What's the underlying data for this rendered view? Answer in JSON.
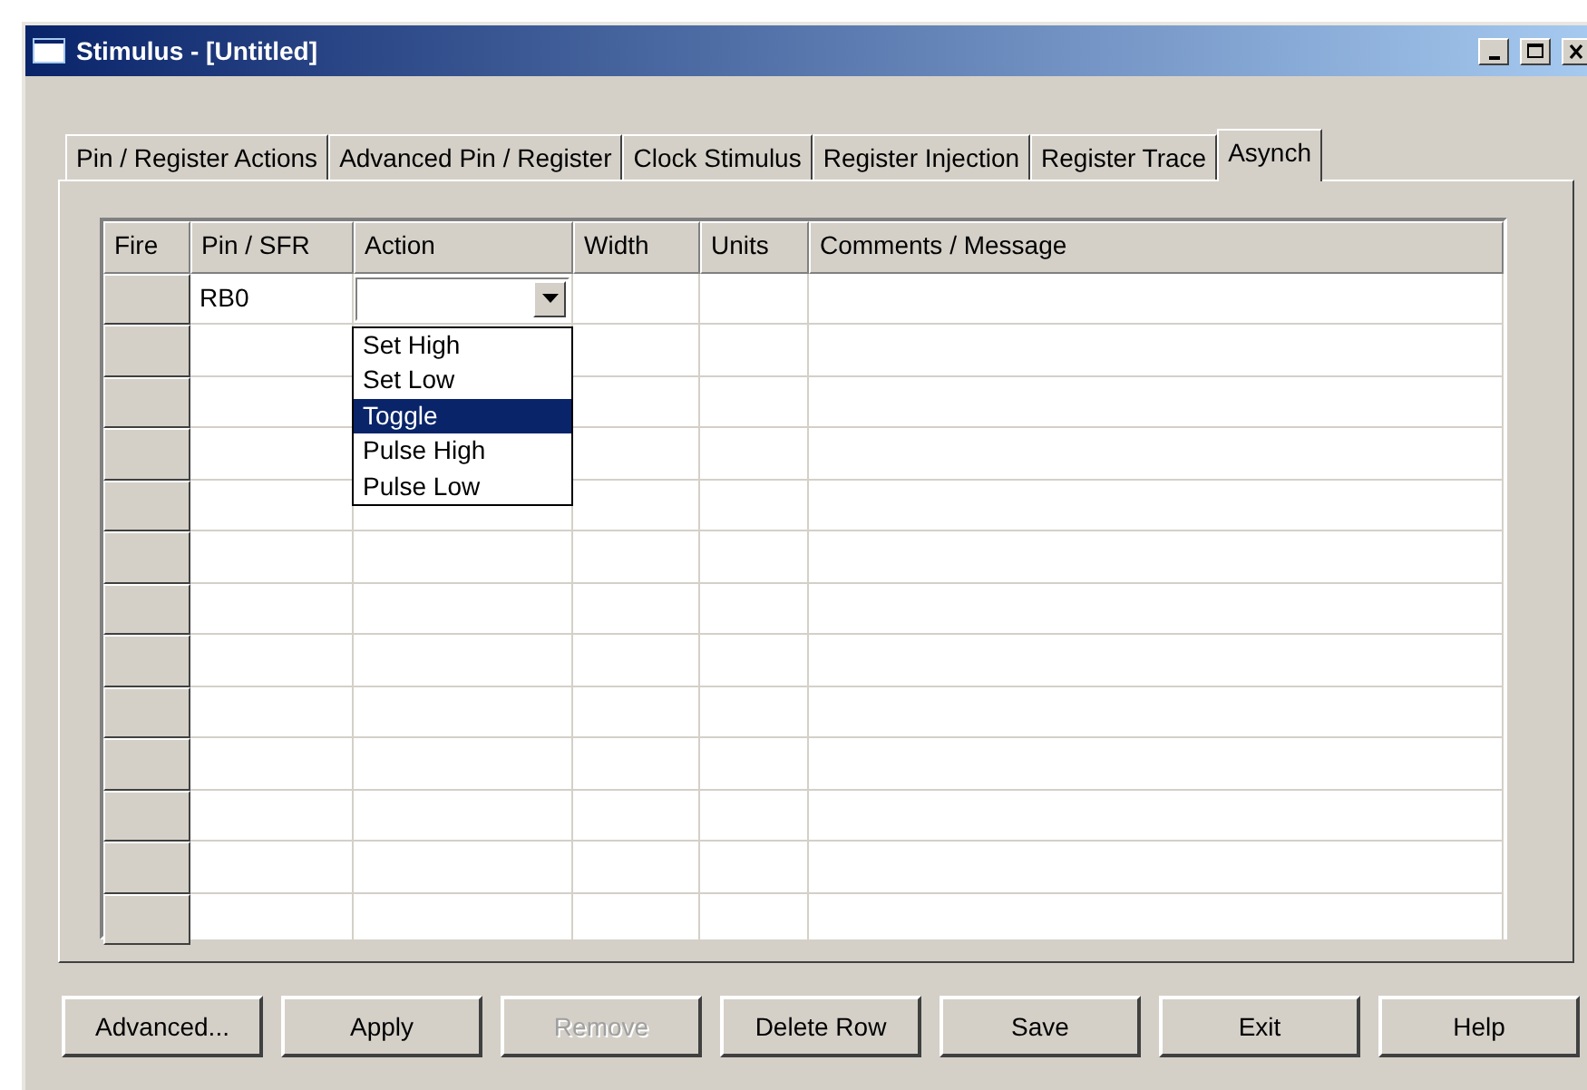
{
  "window": {
    "title": "Stimulus - [Untitled]"
  },
  "tabs": [
    {
      "label": "Pin / Register Actions",
      "selected": false
    },
    {
      "label": "Advanced Pin / Register",
      "selected": false
    },
    {
      "label": "Clock Stimulus",
      "selected": false
    },
    {
      "label": "Register Injection",
      "selected": false
    },
    {
      "label": "Register Trace",
      "selected": false
    },
    {
      "label": "Asynch",
      "selected": true
    }
  ],
  "table": {
    "columns": [
      "Fire",
      "Pin / SFR",
      "Action",
      "Width",
      "Units",
      "Comments / Message"
    ],
    "rows": [
      {
        "kind": "edit",
        "pin_sfr": "RB0",
        "action": {
          "expanded": true,
          "options": [
            {
              "label": "Set High",
              "selected": false
            },
            {
              "label": "Set Low",
              "selected": false
            },
            {
              "label": "Toggle",
              "selected": true
            },
            {
              "label": "Pulse High",
              "selected": false
            },
            {
              "label": "Pulse Low",
              "selected": false
            }
          ]
        }
      },
      {
        "kind": "blank"
      },
      {
        "kind": "blank"
      },
      {
        "kind": "blank"
      },
      {
        "kind": "blank"
      },
      {
        "kind": "blank"
      },
      {
        "kind": "blank"
      },
      {
        "kind": "blank"
      },
      {
        "kind": "blank"
      },
      {
        "kind": "blank"
      },
      {
        "kind": "blank"
      },
      {
        "kind": "blank"
      },
      {
        "kind": "blank"
      }
    ]
  },
  "buttons": [
    {
      "label": "Advanced...",
      "disabled": false
    },
    {
      "label": "Apply",
      "disabled": false
    },
    {
      "label": "Remove",
      "disabled": true
    },
    {
      "label": "Delete Row",
      "disabled": false
    },
    {
      "label": "Save",
      "disabled": false
    },
    {
      "label": "Exit",
      "disabled": false
    },
    {
      "label": "Help",
      "disabled": false
    }
  ]
}
